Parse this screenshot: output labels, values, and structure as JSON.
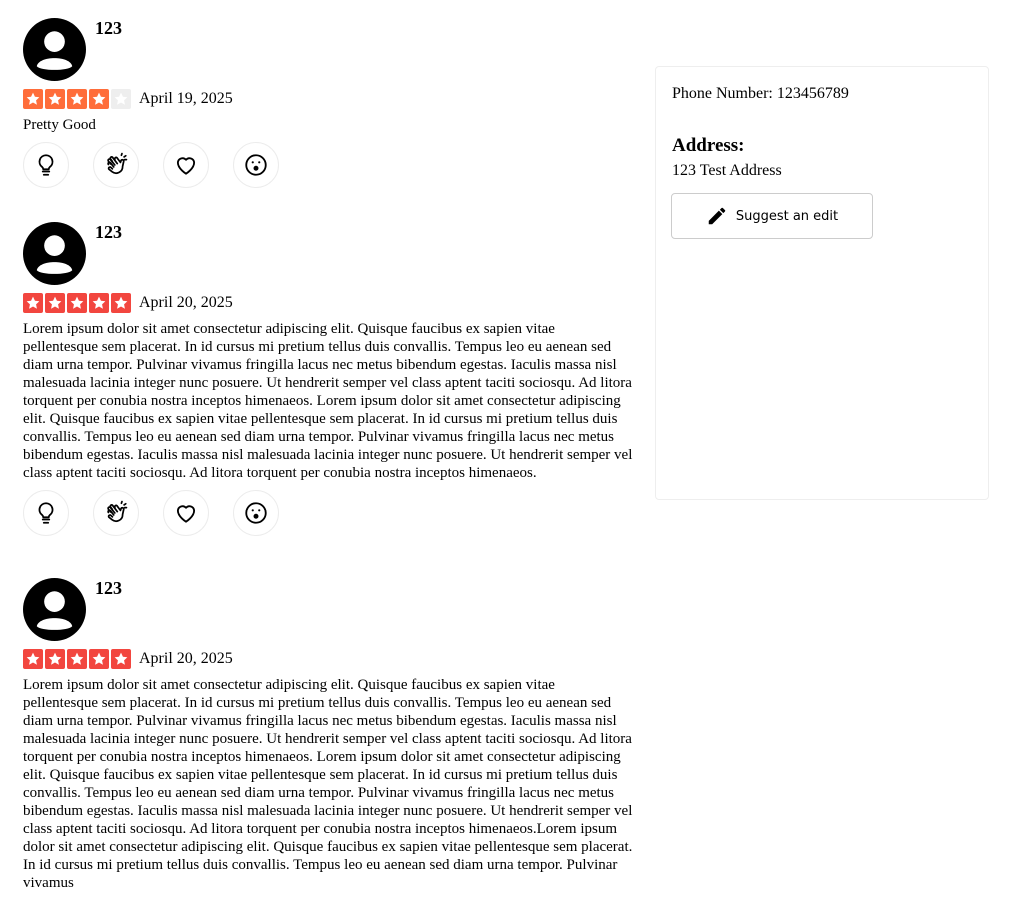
{
  "reviews": [
    {
      "name": "123",
      "rating": 4,
      "max_rating": 5,
      "date": "April 19, 2025",
      "text": "Pretty Good"
    },
    {
      "name": "123",
      "rating": 5,
      "max_rating": 5,
      "date": "April 20, 2025",
      "text": "Lorem ipsum dolor sit amet consectetur adipiscing elit. Quisque faucibus ex sapien vitae pellentesque sem placerat. In id cursus mi pretium tellus duis convallis. Tempus leo eu aenean sed diam urna tempor. Pulvinar vivamus fringilla lacus nec metus bibendum egestas. Iaculis massa nisl malesuada lacinia integer nunc posuere. Ut hendrerit semper vel class aptent taciti sociosqu. Ad litora torquent per conubia nostra inceptos himenaeos. Lorem ipsum dolor sit amet consectetur adipiscing elit. Quisque faucibus ex sapien vitae pellentesque sem placerat. In id cursus mi pretium tellus duis convallis. Tempus leo eu aenean sed diam urna tempor. Pulvinar vivamus fringilla lacus nec metus bibendum egestas. Iaculis massa nisl malesuada lacinia integer nunc posuere. Ut hendrerit semper vel class aptent taciti sociosqu. Ad litora torquent per conubia nostra inceptos himenaeos."
    },
    {
      "name": "123",
      "rating": 5,
      "max_rating": 5,
      "date": "April 20, 2025",
      "text": "Lorem ipsum dolor sit amet consectetur adipiscing elit. Quisque faucibus ex sapien vitae pellentesque sem placerat. In id cursus mi pretium tellus duis convallis. Tempus leo eu aenean sed diam urna tempor. Pulvinar vivamus fringilla lacus nec metus bibendum egestas. Iaculis massa nisl malesuada lacinia integer nunc posuere. Ut hendrerit semper vel class aptent taciti sociosqu. Ad litora torquent per conubia nostra inceptos himenaeos. Lorem ipsum dolor sit amet consectetur adipiscing elit. Quisque faucibus ex sapien vitae pellentesque sem placerat. In id cursus mi pretium tellus duis convallis. Tempus leo eu aenean sed diam urna tempor. Pulvinar vivamus fringilla lacus nec metus bibendum egestas. Iaculis massa nisl malesuada lacinia integer nunc posuere. Ut hendrerit semper vel class aptent taciti sociosqu. Ad litora torquent per conubia nostra inceptos himenaeos.Lorem ipsum dolor sit amet consectetur adipiscing elit. Quisque faucibus ex sapien vitae pellentesque sem placerat. In id cursus mi pretium tellus duis convallis. Tempus leo eu aenean sed diam urna tempor. Pulvinar vivamus"
    }
  ],
  "reaction_icons": [
    "lightbulb-icon",
    "clapping-hands-icon",
    "heart-icon",
    "surprised-face-icon"
  ],
  "sidebar": {
    "phone": "Phone Number: 123456789",
    "address_title": "Address:",
    "address_value": "123 Test Address",
    "edit_label": "Suggest an edit",
    "edit_icon": "pencil-icon"
  },
  "colors": {
    "star_rating_4": "#ff6d3a",
    "star_rating_5": "#f2463f",
    "star_empty": "#eeeeee"
  }
}
